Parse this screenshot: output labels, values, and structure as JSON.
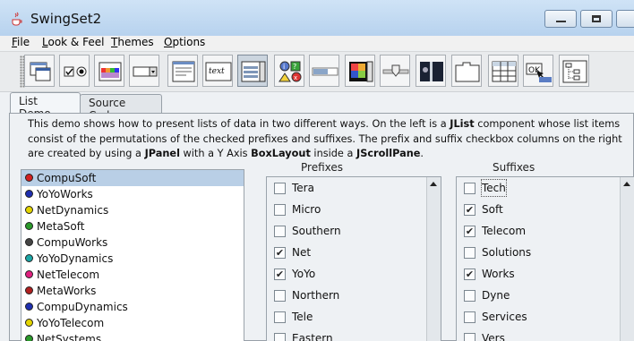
{
  "window": {
    "title": "SwingSet2"
  },
  "menubar": {
    "items": [
      "File",
      "Look & Feel",
      "Themes",
      "Options"
    ]
  },
  "toolbar": {
    "items": [
      "internal-frame-icon",
      "buttons-icon",
      "color-chooser-icon",
      "combobox-icon",
      "file-chooser-icon",
      "html-text-icon",
      "list-icon",
      "option-pane-icon",
      "progress-bar-icon",
      "scroll-pane-icon",
      "slider-icon",
      "split-pane-icon",
      "tabbed-pane-icon",
      "table-icon",
      "tooltip-icon",
      "tree-icon"
    ],
    "selected": "list-icon",
    "tooltip_label": "OK"
  },
  "tabs": [
    {
      "label": "List Demo",
      "active": true
    },
    {
      "label": "Source Code",
      "active": false
    }
  ],
  "description": {
    "seg1": "This demo shows how to present lists of data in two different ways. On the left is a ",
    "jlist": "JList",
    "seg2": " component whose list items consist of the permutations of the checked prefixes and suffixes. The prefix and suffix checkbox columns on the right are created by using a ",
    "jpanel": "JPanel",
    "seg3": " with a Y Axis ",
    "boxlayout": "BoxLayout",
    "seg4": " inside a ",
    "jscrollpane": "JScrollPane",
    "seg5": "."
  },
  "list": {
    "items": [
      {
        "label": "CompuSoft",
        "color": "#d22020",
        "selected": true
      },
      {
        "label": "YoYoWorks",
        "color": "#1f2fb0",
        "selected": false
      },
      {
        "label": "NetDynamics",
        "color": "#e3d400",
        "selected": false
      },
      {
        "label": "MetaSoft",
        "color": "#2a9a2a",
        "selected": false
      },
      {
        "label": "CompuWorks",
        "color": "#444444",
        "selected": false
      },
      {
        "label": "YoYoDynamics",
        "color": "#1aa6a6",
        "selected": false
      },
      {
        "label": "NetTelecom",
        "color": "#e0207f",
        "selected": false
      },
      {
        "label": "MetaWorks",
        "color": "#b02020",
        "selected": false
      },
      {
        "label": "CompuDynamics",
        "color": "#1f2fb0",
        "selected": false
      },
      {
        "label": "YoYoTelecom",
        "color": "#e3d400",
        "selected": false
      },
      {
        "label": "NetSystems",
        "color": "#2a9a2a",
        "selected": false
      }
    ]
  },
  "prefixes": {
    "header": "Prefixes",
    "items": [
      {
        "label": "Tera",
        "checked": false
      },
      {
        "label": "Micro",
        "checked": false
      },
      {
        "label": "Southern",
        "checked": false
      },
      {
        "label": "Net",
        "checked": true
      },
      {
        "label": "YoYo",
        "checked": true
      },
      {
        "label": "Northern",
        "checked": false
      },
      {
        "label": "Tele",
        "checked": false
      },
      {
        "label": "Eastern",
        "checked": false
      }
    ]
  },
  "suffixes": {
    "header": "Suffixes",
    "items": [
      {
        "label": "Tech",
        "checked": false,
        "focused": true
      },
      {
        "label": "Soft",
        "checked": true
      },
      {
        "label": "Telecom",
        "checked": true
      },
      {
        "label": "Solutions",
        "checked": false
      },
      {
        "label": "Works",
        "checked": true
      },
      {
        "label": "Dyne",
        "checked": false
      },
      {
        "label": "Services",
        "checked": false
      },
      {
        "label": "Vers",
        "checked": false
      }
    ]
  }
}
